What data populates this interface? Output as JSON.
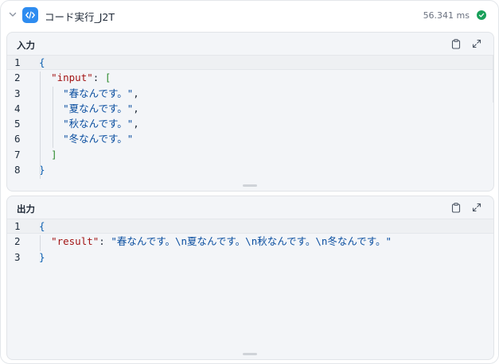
{
  "node": {
    "title": "コード実行_J2T",
    "elapsed": "56.341 ms",
    "icons": {
      "collapse": "chevron-down-icon",
      "type": "code-icon",
      "status": "check-circle-icon",
      "copy": "clipboard-icon",
      "expand": "expand-icon"
    },
    "colors": {
      "accent": "#2e8cf0",
      "success": "#19a05a"
    }
  },
  "input_panel": {
    "title": "入力",
    "lines": [
      {
        "n": "1",
        "tokens": [
          [
            "punc",
            "{"
          ]
        ]
      },
      {
        "n": "2",
        "tokens": [
          [
            "plain",
            "  "
          ],
          [
            "key",
            "\"input\""
          ],
          [
            "plain",
            ": "
          ],
          [
            "brk2",
            "["
          ]
        ]
      },
      {
        "n": "3",
        "tokens": [
          [
            "plain",
            "    "
          ],
          [
            "str",
            "\"春なんです。\""
          ],
          [
            "plain",
            ","
          ]
        ]
      },
      {
        "n": "4",
        "tokens": [
          [
            "plain",
            "    "
          ],
          [
            "str",
            "\"夏なんです。\""
          ],
          [
            "plain",
            ","
          ]
        ]
      },
      {
        "n": "5",
        "tokens": [
          [
            "plain",
            "    "
          ],
          [
            "str",
            "\"秋なんです。\""
          ],
          [
            "plain",
            ","
          ]
        ]
      },
      {
        "n": "6",
        "tokens": [
          [
            "plain",
            "    "
          ],
          [
            "str",
            "\"冬なんです。\""
          ]
        ]
      },
      {
        "n": "7",
        "tokens": [
          [
            "plain",
            "  "
          ],
          [
            "brk2",
            "]"
          ]
        ]
      },
      {
        "n": "8",
        "tokens": [
          [
            "punc",
            "}"
          ]
        ]
      }
    ]
  },
  "output_panel": {
    "title": "出力",
    "lines": [
      {
        "n": "1",
        "tokens": [
          [
            "punc",
            "{"
          ]
        ]
      },
      {
        "n": "2",
        "tokens": [
          [
            "plain",
            "  "
          ],
          [
            "key",
            "\"result\""
          ],
          [
            "plain",
            ": "
          ],
          [
            "str",
            "\"春なんです。\\n夏なんです。\\n秋なんです。\\n冬なんです。\""
          ]
        ]
      },
      {
        "n": "3",
        "tokens": [
          [
            "punc",
            "}"
          ]
        ]
      }
    ]
  }
}
